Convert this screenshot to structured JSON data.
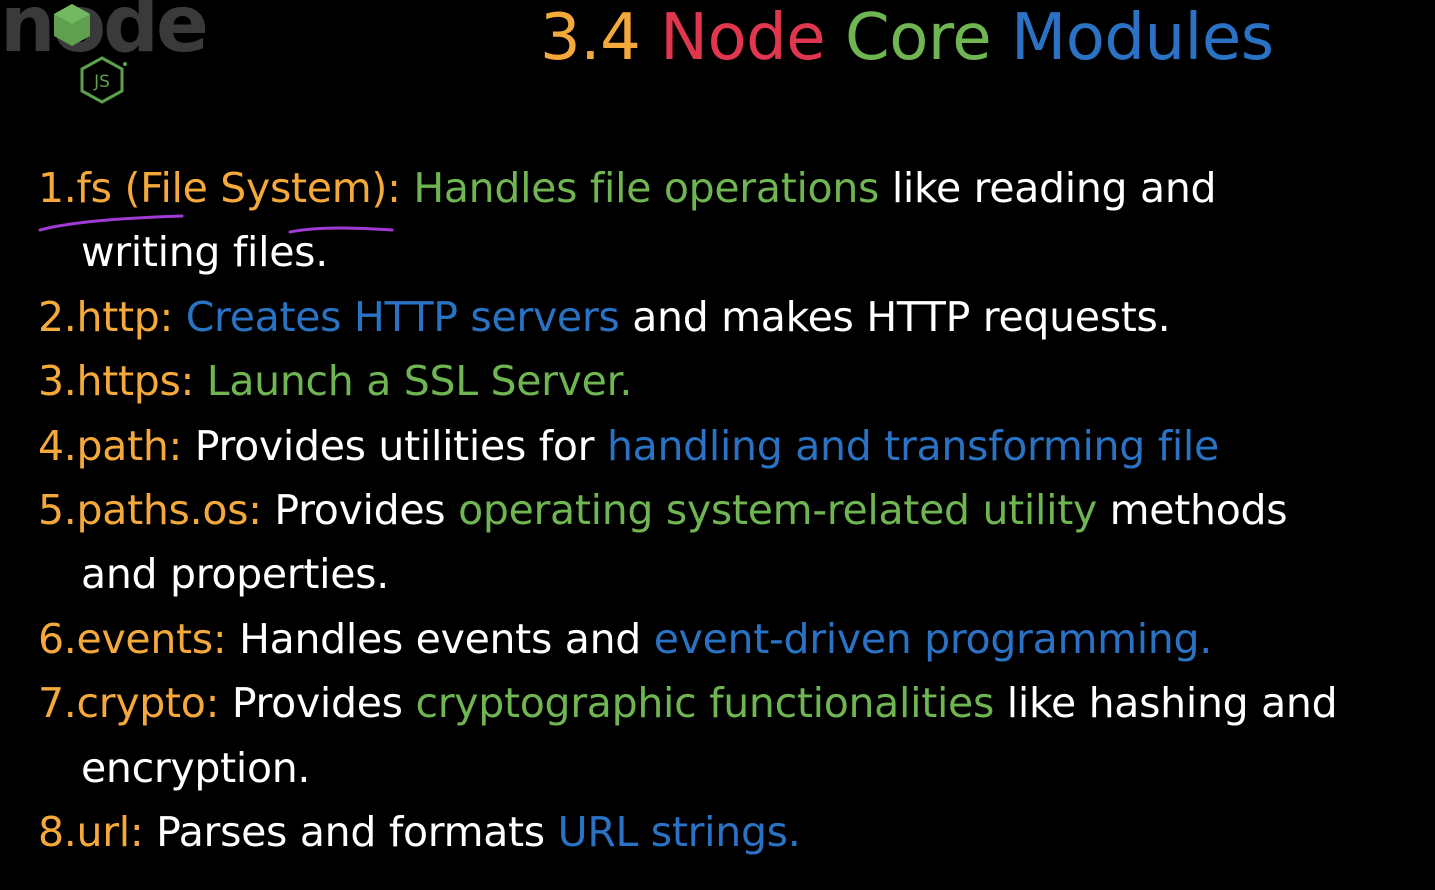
{
  "logo": {
    "wordmark": "node",
    "badge": "JS",
    "colors": {
      "wordmark": "#3a3a3a",
      "hexagon": "#5fa04e",
      "badge_stroke": "#5fa04e"
    }
  },
  "title": {
    "number": "3.4",
    "word1": "Node",
    "word2": "Core",
    "word3": "Modules",
    "colors": {
      "number": "#f4a93a",
      "word1": "#e0364e",
      "word2": "#6fb552",
      "word3": "#2a72c4"
    }
  },
  "colors": {
    "key": "#f4a93a",
    "text": "#ffffff",
    "green": "#6fb552",
    "blue": "#2a72c4",
    "annotation": "#a23ad6"
  },
  "modules": [
    {
      "key": "1.fs (File System):",
      "lines": [
        [
          {
            "text": " Handles file operations",
            "color": "green"
          },
          {
            "text": " like reading and",
            "color": "white"
          }
        ],
        [
          {
            "text": "writing files.",
            "color": "white"
          }
        ]
      ]
    },
    {
      "key": "2.http:",
      "lines": [
        [
          {
            "text": " Creates HTTP servers",
            "color": "blue"
          },
          {
            "text": " and makes HTTP requests.",
            "color": "white"
          }
        ]
      ]
    },
    {
      "key": "3.https:",
      "lines": [
        [
          {
            "text": " Launch a SSL Server.",
            "color": "green"
          }
        ]
      ]
    },
    {
      "key": "4.path:",
      "lines": [
        [
          {
            "text": " Provides utilities for ",
            "color": "white"
          },
          {
            "text": "handling and transforming file",
            "color": "blue"
          }
        ]
      ]
    },
    {
      "key": "5.paths.os:",
      "lines": [
        [
          {
            "text": " Provides ",
            "color": "white"
          },
          {
            "text": "operating system-related utility",
            "color": "green"
          },
          {
            "text": " methods",
            "color": "white"
          }
        ],
        [
          {
            "text": "and properties.",
            "color": "white"
          }
        ]
      ]
    },
    {
      "key": "6.events:",
      "lines": [
        [
          {
            "text": " Handles events and ",
            "color": "white"
          },
          {
            "text": "event-driven programming.",
            "color": "blue"
          }
        ]
      ]
    },
    {
      "key": "7.crypto:",
      "lines": [
        [
          {
            "text": " Provides ",
            "color": "white"
          },
          {
            "text": "cryptographic functionalities",
            "color": "green"
          },
          {
            "text": " like hashing and",
            "color": "white"
          }
        ],
        [
          {
            "text": "encryption.",
            "color": "white"
          }
        ]
      ]
    },
    {
      "key": "8.url:",
      "lines": [
        [
          {
            "text": " Parses and formats ",
            "color": "white"
          },
          {
            "text": "URL strings.",
            "color": "blue"
          }
        ]
      ]
    }
  ]
}
